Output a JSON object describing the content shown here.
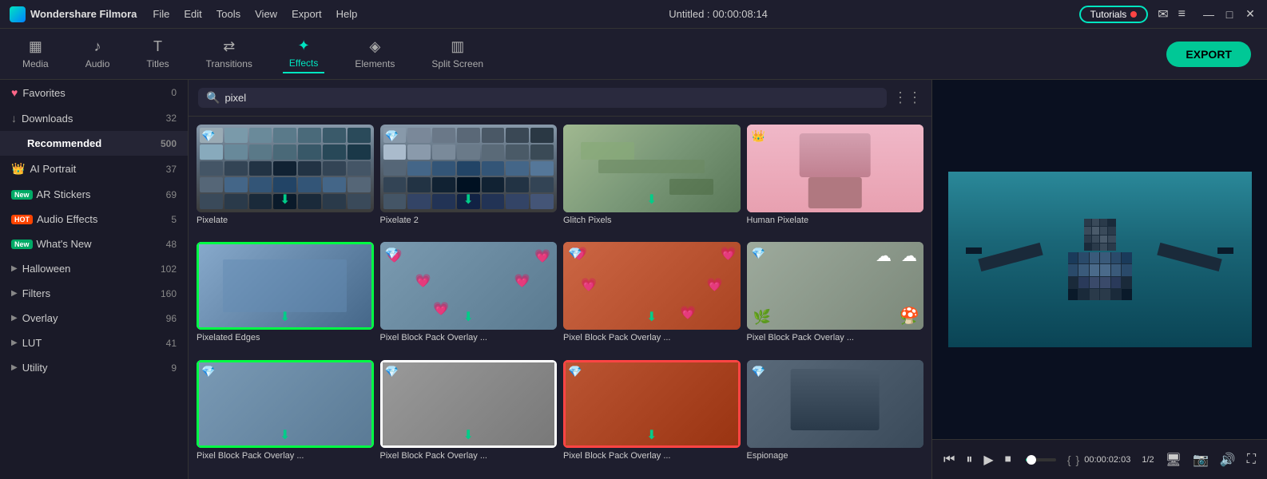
{
  "app": {
    "name": "Wondershare Filmora",
    "logo": "F",
    "title": "Untitled : 00:00:08:14"
  },
  "menu": {
    "items": [
      "File",
      "Edit",
      "Tools",
      "View",
      "Export",
      "Help"
    ]
  },
  "titlebar": {
    "tutorials_label": "Tutorials",
    "mail_icon": "✉",
    "list_icon": "≡"
  },
  "toolbar": {
    "items": [
      {
        "id": "media",
        "label": "Media",
        "icon": "▦"
      },
      {
        "id": "audio",
        "label": "Audio",
        "icon": "♪"
      },
      {
        "id": "titles",
        "label": "Titles",
        "icon": "T"
      },
      {
        "id": "transitions",
        "label": "Transitions",
        "icon": "⇄"
      },
      {
        "id": "effects",
        "label": "Effects",
        "icon": "✦"
      },
      {
        "id": "elements",
        "label": "Elements",
        "icon": "◈"
      },
      {
        "id": "split-screen",
        "label": "Split Screen",
        "icon": "▥"
      }
    ],
    "active": "effects",
    "export_label": "EXPORT"
  },
  "sidebar": {
    "items": [
      {
        "id": "favorites",
        "label": "Favorites",
        "count": 0,
        "badge": "",
        "icon": "heart"
      },
      {
        "id": "downloads",
        "label": "Downloads",
        "count": 32,
        "badge": "",
        "icon": ""
      },
      {
        "id": "recommended",
        "label": "Recommended",
        "count": 500,
        "badge": "",
        "icon": "",
        "active": true
      },
      {
        "id": "ai-portrait",
        "label": "AI Portrait",
        "count": 37,
        "badge": "",
        "icon": "crown"
      },
      {
        "id": "ar-stickers",
        "label": "AR Stickers",
        "count": 69,
        "badge": "new",
        "icon": ""
      },
      {
        "id": "audio-effects",
        "label": "Audio Effects",
        "count": 5,
        "badge": "hot",
        "icon": ""
      },
      {
        "id": "whats-new",
        "label": "What's New",
        "count": 48,
        "badge": "new",
        "icon": ""
      },
      {
        "id": "halloween",
        "label": "Halloween",
        "count": 102,
        "badge": "",
        "icon": "",
        "expand": true
      },
      {
        "id": "filters",
        "label": "Filters",
        "count": 160,
        "badge": "",
        "icon": "",
        "expand": true
      },
      {
        "id": "overlay",
        "label": "Overlay",
        "count": 96,
        "badge": "",
        "icon": "",
        "expand": true
      },
      {
        "id": "lut",
        "label": "LUT",
        "count": 41,
        "badge": "",
        "icon": "",
        "expand": true
      },
      {
        "id": "utility",
        "label": "Utility",
        "count": 9,
        "badge": "",
        "icon": "",
        "expand": true
      }
    ]
  },
  "search": {
    "placeholder": "pixel",
    "value": "pixel"
  },
  "effects": {
    "items": [
      {
        "id": "pixelate",
        "label": "Pixelate",
        "badge": "gem",
        "has_download": true,
        "type": "pixelate"
      },
      {
        "id": "pixelate2",
        "label": "Pixelate 2",
        "badge": "gem",
        "has_download": true,
        "type": "pixelate2"
      },
      {
        "id": "glitch-pixels",
        "label": "Glitch Pixels",
        "badge": "",
        "has_download": true,
        "type": "glitch"
      },
      {
        "id": "human-pixelate",
        "label": "Human Pixelate",
        "badge": "crown",
        "has_download": false,
        "type": "human"
      },
      {
        "id": "pixelated-edges",
        "label": "Pixelated Edges",
        "badge": "",
        "has_download": true,
        "type": "edges"
      },
      {
        "id": "pixel-block-1",
        "label": "Pixel Block Pack Overlay ...",
        "badge": "gem",
        "has_download": true,
        "type": "overlay1"
      },
      {
        "id": "pixel-block-2",
        "label": "Pixel Block Pack Overlay ...",
        "badge": "gem",
        "has_download": true,
        "type": "overlay2"
      },
      {
        "id": "pixel-block-3",
        "label": "Pixel Block Pack Overlay ...",
        "badge": "gem",
        "has_download": false,
        "type": "overlay3"
      },
      {
        "id": "pixel-block-4",
        "label": "Pixel Block Pack Overlay ...",
        "badge": "gem",
        "has_download": true,
        "type": "overlay4"
      },
      {
        "id": "pixel-block-5",
        "label": "Pixel Block Pack Overlay ...",
        "badge": "gem",
        "has_download": true,
        "type": "overlay5"
      },
      {
        "id": "pixel-block-6",
        "label": "Pixel Block Pack Overlay ...",
        "badge": "gem",
        "has_download": true,
        "type": "overlay6"
      },
      {
        "id": "espionage",
        "label": "Espionage",
        "badge": "gem",
        "has_download": false,
        "type": "espionage"
      }
    ]
  },
  "preview": {
    "time_current": "00:00:02:03",
    "speed": "1/2",
    "progress": 20
  }
}
